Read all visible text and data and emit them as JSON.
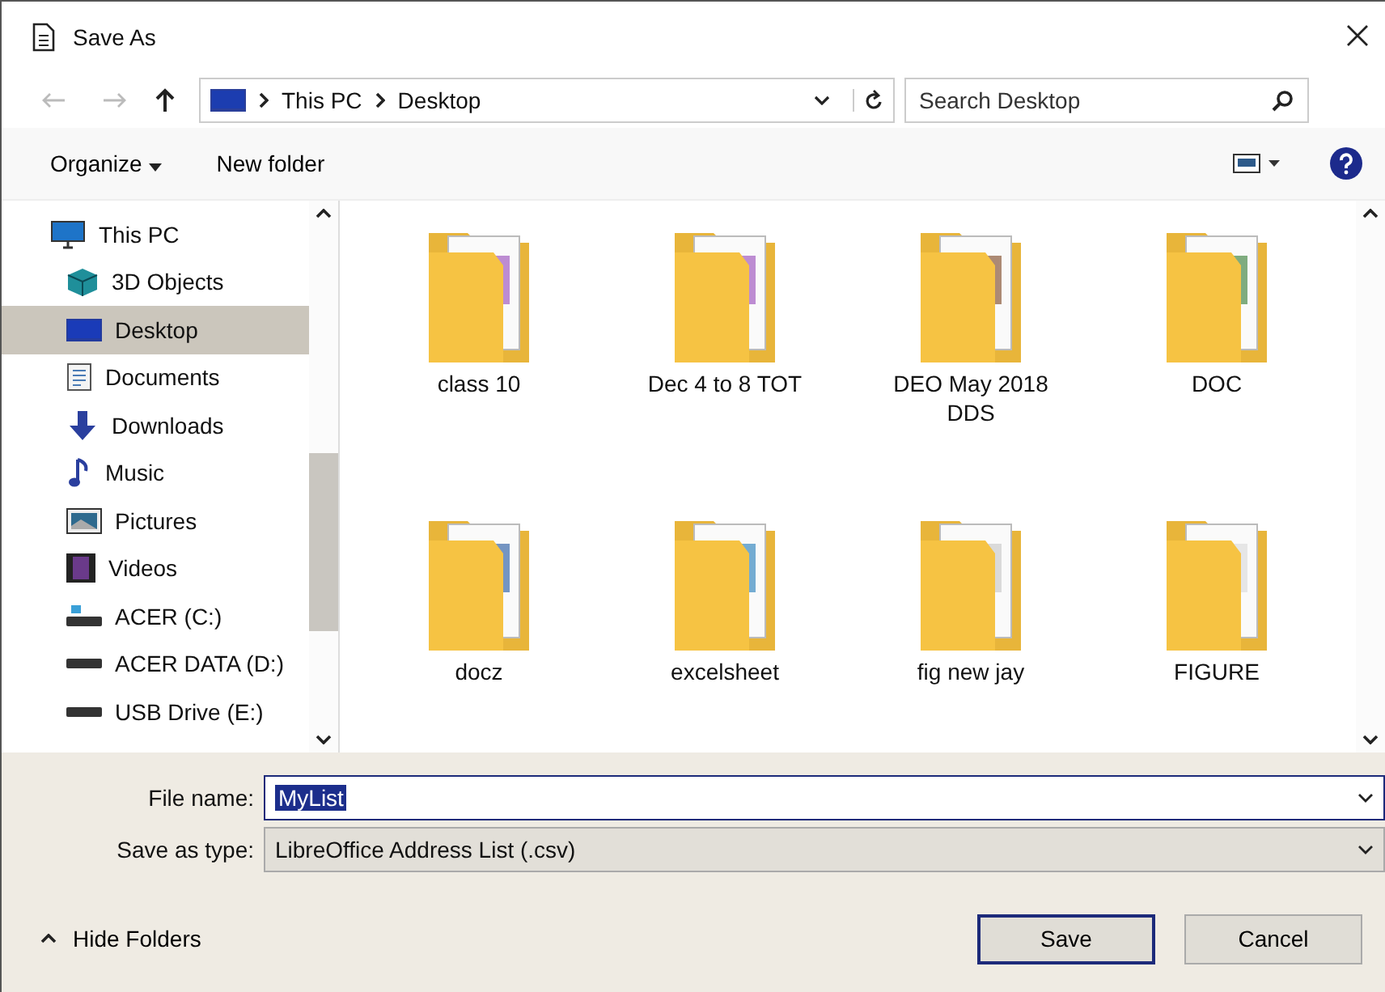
{
  "window": {
    "title": "Save As"
  },
  "breadcrumb": [
    "This PC",
    "Desktop"
  ],
  "search": {
    "placeholder": "Search Desktop"
  },
  "toolbar": {
    "organize": "Organize",
    "new_folder": "New folder"
  },
  "sidebar": {
    "items": [
      {
        "label": "This PC",
        "selected": false,
        "children": [
          {
            "label": "3D Objects",
            "selected": false
          },
          {
            "label": "Desktop",
            "selected": true
          },
          {
            "label": "Documents",
            "selected": false
          },
          {
            "label": "Downloads",
            "selected": false
          },
          {
            "label": "Music",
            "selected": false
          },
          {
            "label": "Pictures",
            "selected": false
          },
          {
            "label": "Videos",
            "selected": false
          },
          {
            "label": "ACER (C:)",
            "selected": false
          },
          {
            "label": "ACER DATA (D:)",
            "selected": false
          },
          {
            "label": "USB Drive (E:)",
            "selected": false
          }
        ]
      }
    ]
  },
  "files": [
    {
      "name": "class 10"
    },
    {
      "name": "Dec 4 to 8 TOT"
    },
    {
      "name": "DEO May 2018 DDS"
    },
    {
      "name": "DOC"
    },
    {
      "name": "docz"
    },
    {
      "name": "excelsheet"
    },
    {
      "name": "fig new jay"
    },
    {
      "name": "FIGURE"
    }
  ],
  "file_name": {
    "label": "File name:",
    "value": "MyList"
  },
  "save_as_type": {
    "label": "Save as type:",
    "value": "LibreOffice Address List (.csv)"
  },
  "hide_folders": "Hide Folders",
  "buttons": [
    {
      "label": "Save",
      "default": true
    },
    {
      "label": "Cancel",
      "default": false
    }
  ]
}
